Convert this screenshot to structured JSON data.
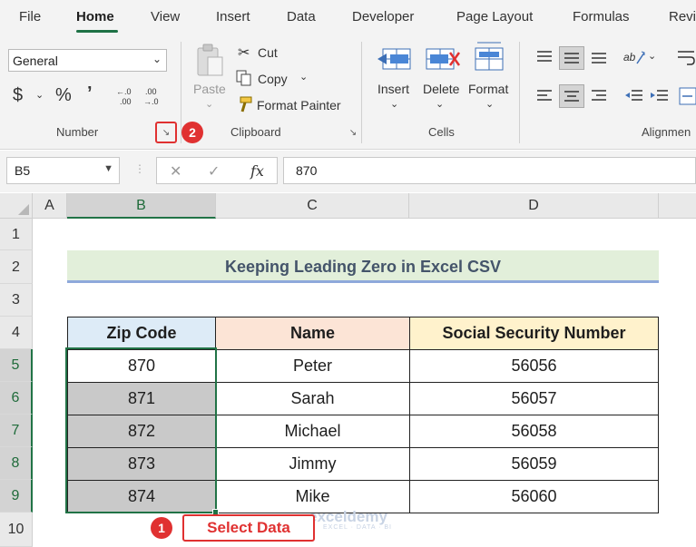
{
  "tabs": [
    "File",
    "Home",
    "View",
    "Insert",
    "Data",
    "Developer",
    "Page Layout",
    "Formulas",
    "Revi"
  ],
  "ribbon": {
    "number_format": "General",
    "number_group": "Number",
    "clipboard_group": "Clipboard",
    "cells_group": "Cells",
    "alignment_group": "Alignmen",
    "paste": "Paste",
    "cut": "Cut",
    "copy": "Copy",
    "format_painter": "Format Painter",
    "insert": "Insert",
    "delete": "Delete",
    "format": "Format",
    "currency_symbol": "$",
    "percent_symbol": "%",
    "comma_symbol": "݉"
  },
  "annotations": {
    "step1_number": "1",
    "step1_label": "Select Data",
    "step2_number": "2"
  },
  "formula_bar": {
    "name_box": "B5",
    "value": "870",
    "fx": "fx"
  },
  "columns": [
    "A",
    "B",
    "C",
    "D"
  ],
  "rows": [
    "1",
    "2",
    "3",
    "4",
    "5",
    "6",
    "7",
    "8",
    "9",
    "10"
  ],
  "sheet": {
    "title": "Keeping Leading Zero in Excel CSV",
    "headers": [
      "Zip Code",
      "Name",
      "Social Security Number"
    ],
    "records": [
      [
        "870",
        "Peter",
        "56056"
      ],
      [
        "871",
        "Sarah",
        "56057"
      ],
      [
        "872",
        "Michael",
        "56058"
      ],
      [
        "873",
        "Jimmy",
        "56059"
      ],
      [
        "874",
        "Mike",
        "56060"
      ]
    ]
  },
  "colors": {
    "accent_green": "#217346",
    "annotation_red": "#e03131",
    "zip_header_bg": "#ddebf7",
    "name_header_bg": "#fce4d6",
    "ssn_header_bg": "#fff2cc",
    "title_bg": "#e2efda"
  },
  "watermark": {
    "brand": "exceldemy",
    "tagline": "EXCEL · DATA · BI"
  }
}
